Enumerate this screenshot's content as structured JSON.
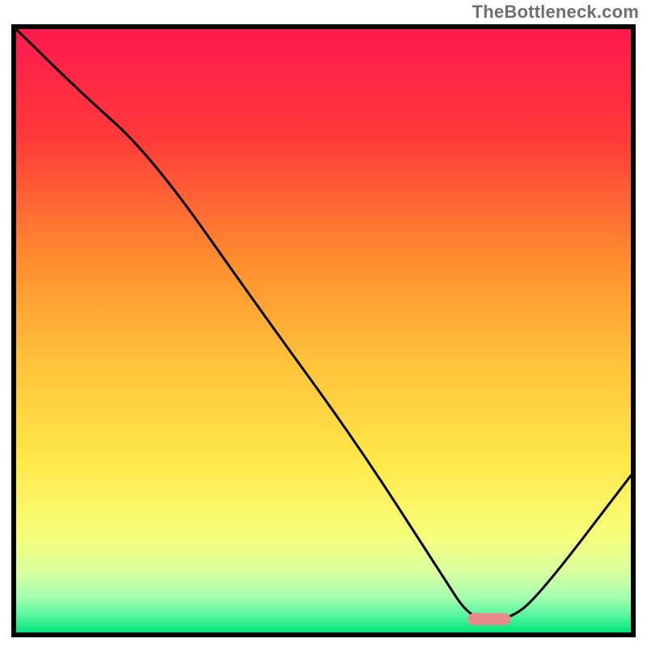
{
  "watermark": {
    "text": "TheBottleneck.com"
  },
  "chart_data": {
    "type": "line",
    "title": "",
    "xlabel": "",
    "ylabel": "",
    "xlim": [
      0,
      100
    ],
    "ylim": [
      0,
      100
    ],
    "background_gradient_stops": [
      {
        "offset": 0.0,
        "color": "#ff1a4d"
      },
      {
        "offset": 0.18,
        "color": "#ff3a3a"
      },
      {
        "offset": 0.38,
        "color": "#ff8c2e"
      },
      {
        "offset": 0.55,
        "color": "#ffc23a"
      },
      {
        "offset": 0.72,
        "color": "#ffe94a"
      },
      {
        "offset": 0.84,
        "color": "#f6ff7a"
      },
      {
        "offset": 0.9,
        "color": "#d9ffa0"
      },
      {
        "offset": 0.94,
        "color": "#a7ffb0"
      },
      {
        "offset": 0.97,
        "color": "#5cf7a0"
      },
      {
        "offset": 1.0,
        "color": "#00e57a"
      }
    ],
    "series": [
      {
        "name": "bottleneck-curve",
        "color": "#000000",
        "x": [
          0,
          10,
          22,
          40,
          55,
          69,
          74,
          80,
          85,
          100
        ],
        "values": [
          100,
          90,
          79,
          53,
          32,
          10,
          2,
          2,
          6,
          26
        ]
      }
    ],
    "marker": {
      "name": "optimal-zone-marker",
      "shape": "rounded-rect",
      "color": "#e98b8b",
      "x_center": 77,
      "y_center": 2.2,
      "width": 7,
      "height": 2
    }
  }
}
